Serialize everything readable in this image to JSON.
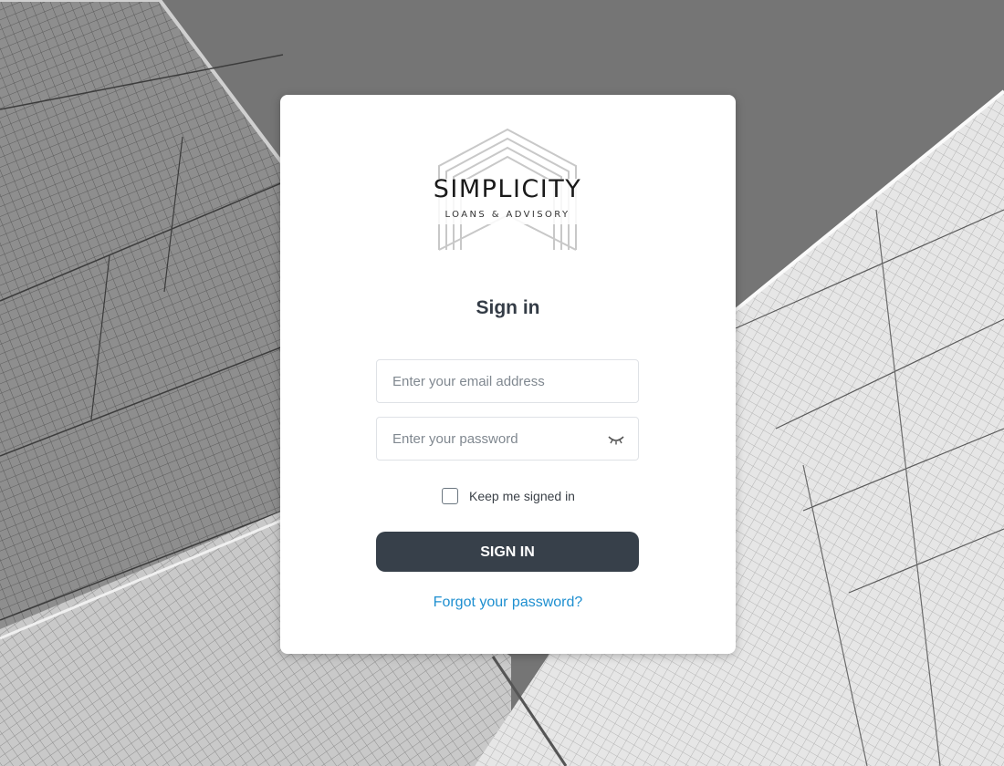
{
  "brand": {
    "name": "SIMPLICITY",
    "tagline": "LOANS & ADVISORY"
  },
  "form": {
    "title": "Sign in",
    "email_placeholder": "Enter your email address",
    "email_value": "",
    "password_placeholder": "Enter your password",
    "password_value": "",
    "password_toggle_icon": "eye-closed-icon",
    "remember_label": "Keep me signed in",
    "remember_checked": false,
    "submit_label": "SIGN IN",
    "forgot_label": "Forgot your password?"
  },
  "colors": {
    "button": "#37404a",
    "link": "#1e8fd0",
    "title": "#343c46"
  }
}
